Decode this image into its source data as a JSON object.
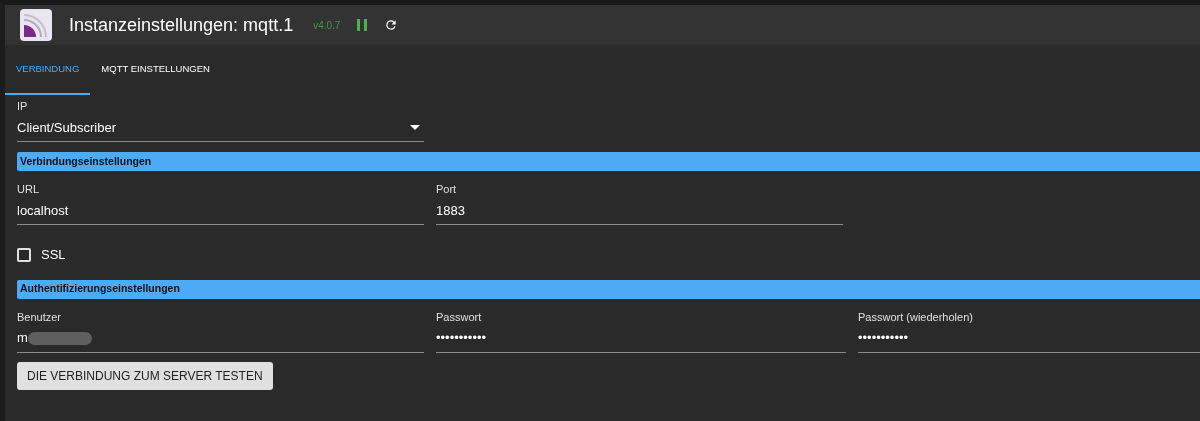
{
  "header": {
    "title": "Instanzeinstellungen: mqtt.1",
    "version": "v4.0.7",
    "running": true
  },
  "tabs": [
    {
      "label": "VERBINDUNG",
      "selected": true
    },
    {
      "label": "MQTT EINSTELLUNGEN",
      "selected": false
    }
  ],
  "ip_select": {
    "label": "IP",
    "value": "Client/Subscriber"
  },
  "sections": [
    {
      "title": "Verbindungseinstellungen",
      "fields": [
        {
          "label": "URL",
          "value": "localhost",
          "redacted": false
        },
        {
          "label": "Port",
          "value": "1883",
          "redacted": false
        }
      ],
      "checkbox": {
        "label": "SSL",
        "checked": false
      }
    },
    {
      "title": "Authentifizierungseinstellungen",
      "fields": [
        {
          "label": "Benutzer",
          "value": "m",
          "redacted": true
        },
        {
          "label": "Passwort",
          "value": "•••••••••••",
          "redacted": false
        },
        {
          "label": "Passwort (wiederholen)",
          "value": "•••••••••••",
          "redacted": false
        }
      ]
    }
  ],
  "test_button": "DIE VERBINDUNG ZUM SERVER TESTEN"
}
